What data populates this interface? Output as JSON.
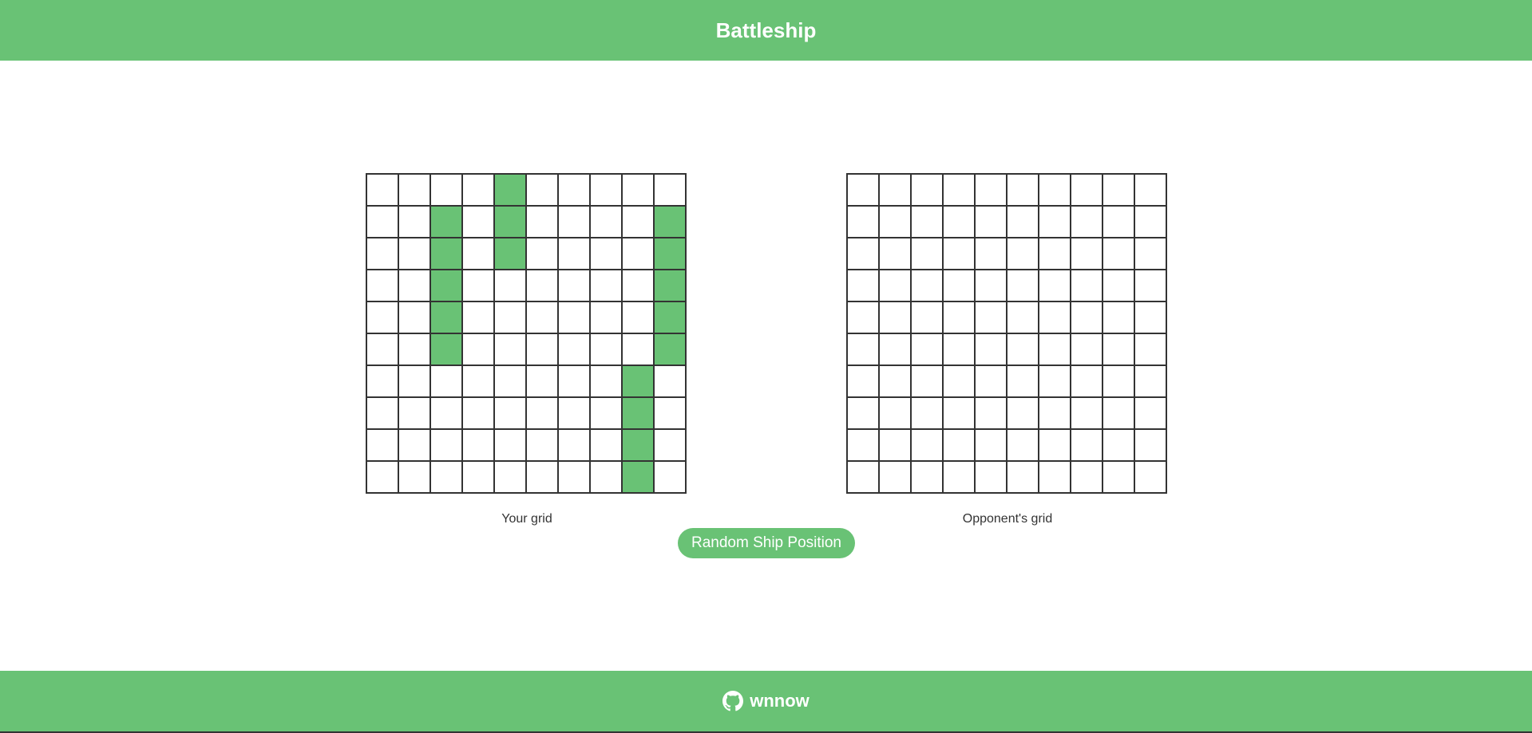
{
  "header": {
    "title": "Battleship"
  },
  "boards": {
    "your": {
      "label": "Your grid",
      "size": 10,
      "ship_cells": [
        [
          0,
          4
        ],
        [
          1,
          2
        ],
        [
          1,
          4
        ],
        [
          1,
          9
        ],
        [
          2,
          2
        ],
        [
          2,
          4
        ],
        [
          2,
          9
        ],
        [
          3,
          2
        ],
        [
          3,
          9
        ],
        [
          4,
          2
        ],
        [
          4,
          9
        ],
        [
          5,
          2
        ],
        [
          5,
          9
        ],
        [
          6,
          8
        ],
        [
          7,
          8
        ],
        [
          8,
          8
        ],
        [
          9,
          8
        ]
      ]
    },
    "opponent": {
      "label": "Opponent's grid",
      "size": 10,
      "ship_cells": []
    }
  },
  "controls": {
    "random_button_label": "Random Ship Position"
  },
  "footer": {
    "github_user": "wnnow",
    "icon": "github-icon"
  },
  "colors": {
    "accent": "#69c275",
    "grid_line": "#333333",
    "cell_empty": "#ffffff",
    "text": "#333333"
  }
}
